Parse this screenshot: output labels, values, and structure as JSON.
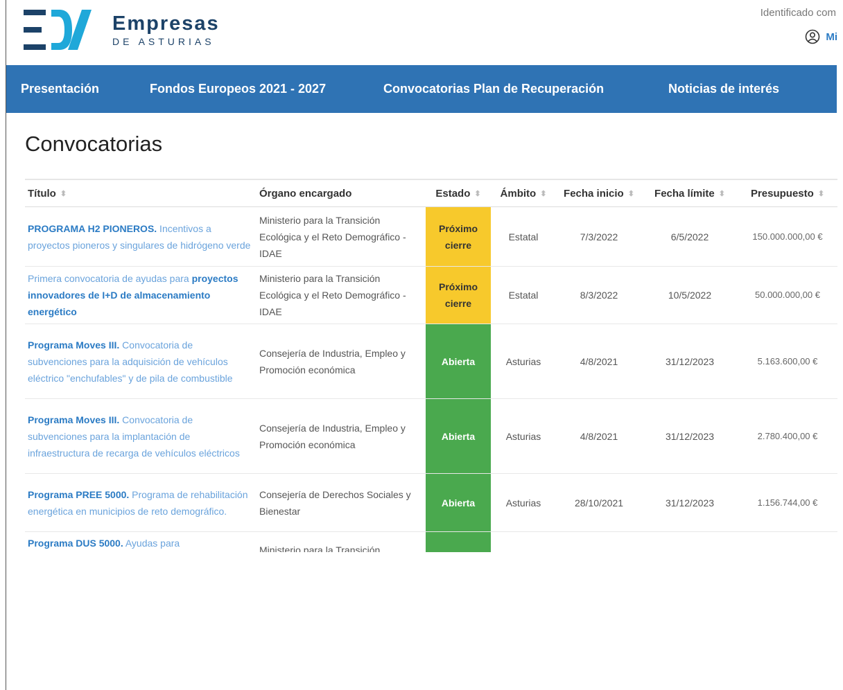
{
  "header": {
    "logo_title": "Empresas",
    "logo_subtitle": "DE ASTURIAS",
    "identified_text": "Identificado com",
    "user_link_label": "Mi"
  },
  "nav": {
    "items": [
      "Presentación",
      "Fondos Europeos 2021 - 2027",
      "Convocatorias Plan de Recuperación",
      "Noticias de interés"
    ]
  },
  "page": {
    "title": "Convocatorias"
  },
  "table": {
    "headers": [
      "Título",
      "Órgano encargado",
      "Estado",
      "Ámbito",
      "Fecha inicio",
      "Fecha límite",
      "Presupuesto"
    ],
    "rows": [
      {
        "title_pre": "",
        "title_bold": "PROGRAMA H2 PIONEROS.",
        "title_post": " Incentivos a proyectos pioneros y singulares de hidrógeno verde",
        "organo": "Ministerio para la Transición Ecológica y el Reto Demográfico - IDAE",
        "estado": "Próximo cierre",
        "ambito": "Estatal",
        "fecha_inicio": "7/3/2022",
        "fecha_limite": "6/5/2022",
        "presupuesto": "150.000.000,00 €"
      },
      {
        "title_pre": "Primera convocatoria de ayudas para ",
        "title_bold": "proyectos innovadores de I+D de almacenamiento energético",
        "title_post": "",
        "organo": "Ministerio para la Transición Ecológica y el Reto Demográfico - IDAE",
        "estado": "Próximo cierre",
        "ambito": "Estatal",
        "fecha_inicio": "8/3/2022",
        "fecha_limite": "10/5/2022",
        "presupuesto": "50.000.000,00 €"
      },
      {
        "title_pre": "",
        "title_bold": "Programa Moves III.",
        "title_post": " Convocatoria de subvenciones para la adquisición de vehículos eléctrico \"enchufables\" y de pila de combustible",
        "organo": "Consejería de Industria, Empleo y Promoción económica",
        "estado": "Abierta",
        "ambito": "Asturias",
        "fecha_inicio": "4/8/2021",
        "fecha_limite": "31/12/2023",
        "presupuesto": "5.163.600,00 €"
      },
      {
        "title_pre": "",
        "title_bold": "Programa Moves III.",
        "title_post": " Convocatoria de subvenciones para la implantación de infraestructura de recarga de vehículos eléctricos",
        "organo": "Consejería de Industria, Empleo y Promoción económica",
        "estado": "Abierta",
        "ambito": "Asturias",
        "fecha_inicio": "4/8/2021",
        "fecha_limite": "31/12/2023",
        "presupuesto": "2.780.400,00 €"
      },
      {
        "title_pre": "",
        "title_bold": "Programa PREE 5000.",
        "title_post": " Programa de rehabilitación energética en municipios de reto demográfico.",
        "organo": "Consejería de Derechos Sociales y Bienestar",
        "estado": "Abierta",
        "ambito": "Asturias",
        "fecha_inicio": "28/10/2021",
        "fecha_limite": "31/12/2023",
        "presupuesto": "1.156.744,00 €"
      },
      {
        "title_pre": "",
        "title_bold": "Programa DUS 5000.",
        "title_post": " Ayudas para",
        "organo": "Ministerio para la Transición",
        "estado": "",
        "ambito": "",
        "fecha_inicio": "",
        "fecha_limite": "",
        "presupuesto": ""
      }
    ]
  },
  "colors": {
    "nav_bg": "#2f73b4",
    "link": "#2b7bc4",
    "status_open": "#4aa94e",
    "status_closing": "#f7c92c"
  },
  "icons": {
    "user": "user-circle-icon",
    "sort": "sort-arrows-icon"
  }
}
